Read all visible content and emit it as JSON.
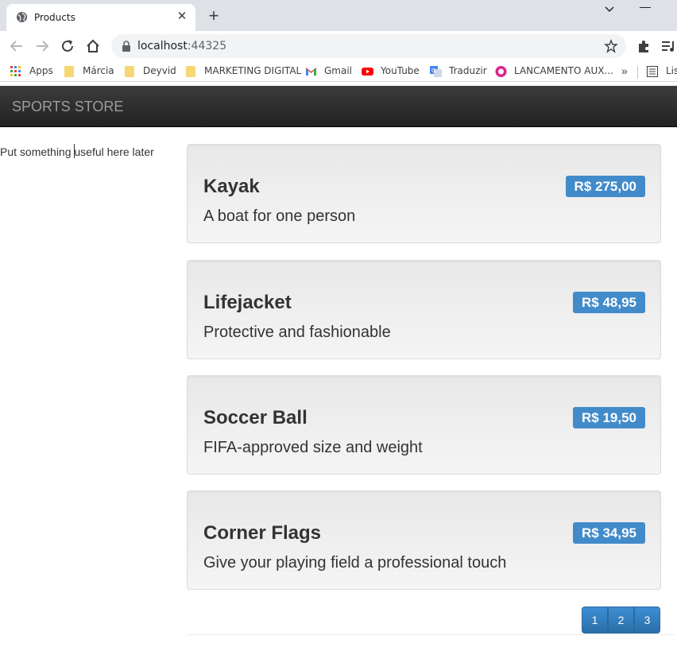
{
  "browser": {
    "tab_title": "Products",
    "new_tab": "+",
    "close": "✕",
    "url_host": "localhost",
    "url_port": ":44325"
  },
  "bookmarks": [
    {
      "label": "Apps",
      "icon": "apps-grid-icon"
    },
    {
      "label": "Márcia",
      "icon": "folder-icon"
    },
    {
      "label": "Deyvid",
      "icon": "folder-icon"
    },
    {
      "label": "MARKETING DIGITAL",
      "icon": "folder-icon"
    },
    {
      "label": "Gmail",
      "icon": "gmail-icon"
    },
    {
      "label": "YouTube",
      "icon": "youtube-icon"
    },
    {
      "label": "Traduzir",
      "icon": "translate-icon"
    },
    {
      "label": "LANCAMENTO AUX...",
      "icon": "site-icon"
    },
    {
      "label": "Lis",
      "icon": "reading-list-icon"
    }
  ],
  "bookmarks_more": "»",
  "store": {
    "brand": "SPORTS STORE",
    "sidebar_text": "Put something useful here later"
  },
  "products": [
    {
      "name": "Kayak",
      "description": "A boat for one person",
      "price": "R$ 275,00"
    },
    {
      "name": "Lifejacket",
      "description": "Protective and fashionable",
      "price": "R$ 48,95"
    },
    {
      "name": "Soccer Ball",
      "description": "FIFA-approved size and weight",
      "price": "R$ 19,50"
    },
    {
      "name": "Corner Flags",
      "description": "Give your playing field a professional touch",
      "price": "R$ 34,95"
    }
  ],
  "pagination": [
    "1",
    "2",
    "3"
  ],
  "colors": {
    "price_badge": "#428bca",
    "navbar": "#222222",
    "pager": "#337ab7"
  }
}
